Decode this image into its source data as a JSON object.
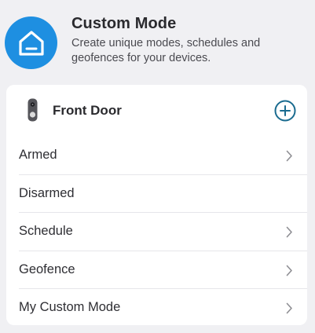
{
  "header": {
    "title": "Custom Mode",
    "subtitle": "Create unique modes, schedules and geofences for your devices.",
    "icon": "house-icon",
    "accent_color": "#1e8fe1"
  },
  "device": {
    "name": "Front Door",
    "icon": "doorbell-icon",
    "add_icon": "plus-circle-icon",
    "add_color": "#1a6b8f"
  },
  "modes": [
    {
      "label": "Armed",
      "has_chevron": true
    },
    {
      "label": "Disarmed",
      "has_chevron": false
    },
    {
      "label": "Schedule",
      "has_chevron": true
    },
    {
      "label": "Geofence",
      "has_chevron": true
    },
    {
      "label": "My Custom Mode",
      "has_chevron": true
    }
  ]
}
